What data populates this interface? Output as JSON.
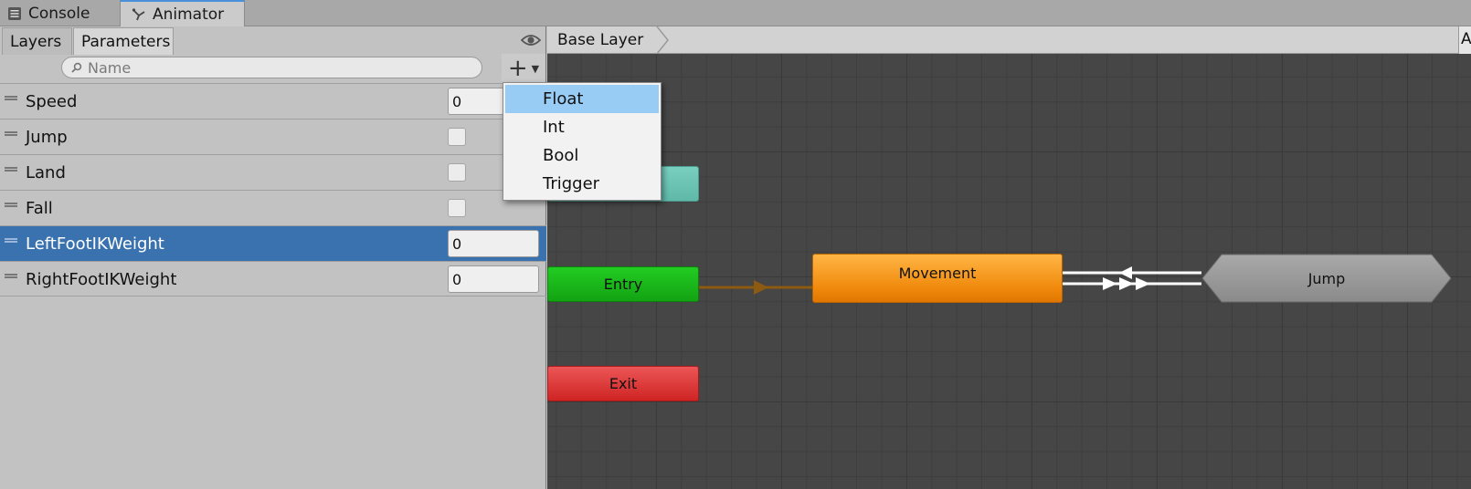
{
  "window_tabs": [
    {
      "label": "Console",
      "icon": "console-icon"
    },
    {
      "label": "Animator",
      "icon": "animator-icon",
      "active": true
    }
  ],
  "left_panel": {
    "tabs": [
      "Layers",
      "Parameters"
    ],
    "active_tab": "Parameters",
    "search_placeholder": "Name",
    "parameters": [
      {
        "name": "Speed",
        "type": "float",
        "value": "0"
      },
      {
        "name": "Jump",
        "type": "bool",
        "checked": false
      },
      {
        "name": "Land",
        "type": "bool",
        "checked": false
      },
      {
        "name": "Fall",
        "type": "bool",
        "checked": false
      },
      {
        "name": "LeftFootIKWeight",
        "type": "float",
        "value": "0",
        "selected": true
      },
      {
        "name": "RightFootIKWeight",
        "type": "float",
        "value": "0"
      }
    ]
  },
  "dropdown": {
    "items": [
      "Float",
      "Int",
      "Bool",
      "Trigger"
    ],
    "highlighted": "Float"
  },
  "graph": {
    "breadcrumb": "Base Layer",
    "breadcrumb_right": "A",
    "nodes": {
      "entry": "Entry",
      "exit": "Exit",
      "movement": "Movement",
      "jump": "Jump"
    }
  },
  "colors": {
    "selection": "#3a72b0",
    "entry": "#1bbf1b",
    "exit": "#de3a3a",
    "any_state": "#6fc6b6",
    "default_state": "#f39a1e",
    "state": "#9a9a9a",
    "graph_bg": "#464646",
    "menu_highlight": "#99ccf5"
  }
}
